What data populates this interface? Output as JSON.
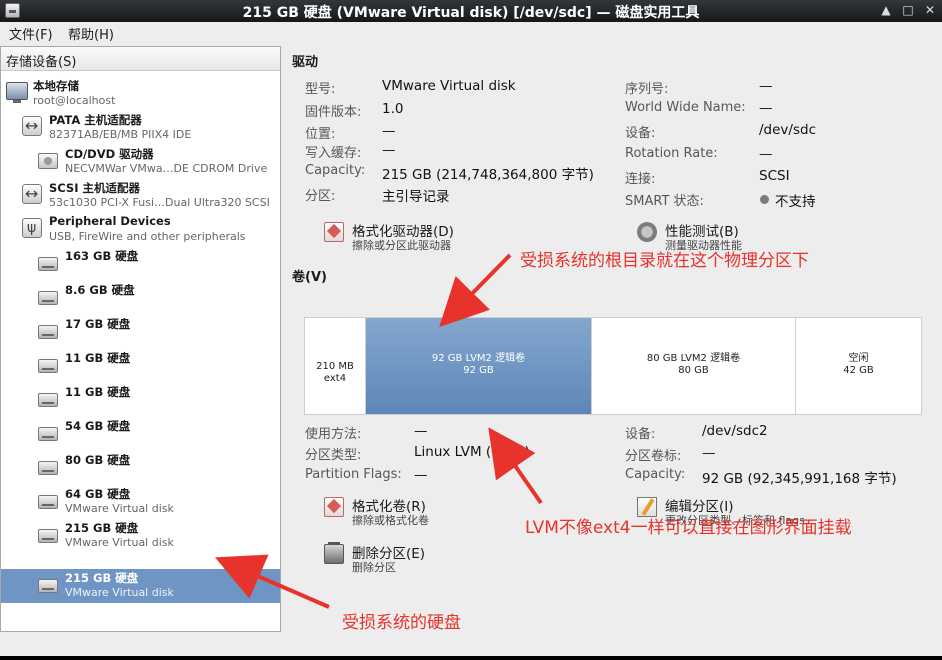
{
  "window": {
    "title": "215 GB 硬盘 (VMware Virtual disk) [/dev/sdc] — 磁盘实用工具",
    "controls": {
      "minimize": "▲",
      "close": "✕"
    }
  },
  "menubar": {
    "items": [
      "文件(F)",
      "帮助(H)"
    ]
  },
  "sidebar": {
    "header": "存储设备(S)",
    "items": [
      {
        "title": "本地存储",
        "sub": "root@localhost",
        "icon": "computer-icon"
      },
      {
        "title": "PATA 主机适配器",
        "sub": "82371AB/EB/MB PIIX4 IDE",
        "icon": "hba-icon"
      },
      {
        "title": "CD/DVD 驱动器",
        "sub": "NECVMWar VMwa…DE CDROM Drive",
        "icon": "cdrom-icon"
      },
      {
        "title": "SCSI 主机适配器",
        "sub": "53c1030 PCI-X Fusi…Dual Ultra320 SCSI",
        "icon": "hba-icon"
      },
      {
        "title": "Peripheral Devices",
        "sub": "USB, FireWire and other peripherals",
        "icon": "usb-icon"
      },
      {
        "title": "163 GB 硬盘",
        "sub": "",
        "icon": "disk-icon"
      },
      {
        "title": "8.6 GB 硬盘",
        "sub": "",
        "icon": "disk-icon"
      },
      {
        "title": "17 GB 硬盘",
        "sub": "",
        "icon": "disk-icon"
      },
      {
        "title": "11 GB 硬盘",
        "sub": "",
        "icon": "disk-icon"
      },
      {
        "title": "11 GB 硬盘",
        "sub": "",
        "icon": "disk-icon"
      },
      {
        "title": "54 GB 硬盘",
        "sub": "",
        "icon": "disk-icon"
      },
      {
        "title": "80 GB 硬盘",
        "sub": "",
        "icon": "disk-icon"
      },
      {
        "title": "64 GB 硬盘",
        "sub": "VMware Virtual disk",
        "icon": "disk-icon"
      },
      {
        "title": "215 GB 硬盘",
        "sub": "VMware Virtual disk",
        "icon": "disk-icon"
      },
      {
        "title": "215 GB 硬盘",
        "sub": "VMware Virtual disk",
        "icon": "disk-icon",
        "selected": true
      }
    ]
  },
  "drive": {
    "section_title": "驱动",
    "left": [
      {
        "label": "型号:",
        "value": "VMware Virtual disk"
      },
      {
        "label": "固件版本:",
        "value": "1.0"
      },
      {
        "label": "位置:",
        "value": "—"
      },
      {
        "label": "写入缓存:",
        "value": "—"
      },
      {
        "label": "Capacity:",
        "value": "215 GB (214,748,364,800 字节)"
      },
      {
        "label": "分区:",
        "value": "主引导记录"
      }
    ],
    "right": [
      {
        "label": "序列号:",
        "value": "—"
      },
      {
        "label": "World Wide Name:",
        "value": "—"
      },
      {
        "label": "设备:",
        "value": "/dev/sdc"
      },
      {
        "label": "Rotation Rate:",
        "value": "—"
      },
      {
        "label": "连接:",
        "value": "SCSI"
      },
      {
        "label": "SMART 状态:",
        "value": "不支持"
      }
    ],
    "actions": [
      {
        "label": "格式化驱动器(D)",
        "desc": "擦除或分区此驱动器",
        "icon": "format-icon"
      },
      {
        "label": "性能测试(B)",
        "desc": "测量驱动器性能",
        "icon": "benchmark-icon"
      }
    ]
  },
  "volumes": {
    "section_title": "卷(V)",
    "segments": [
      {
        "label1": "210 MB ext4",
        "label2": "",
        "kind": "ext4"
      },
      {
        "label1": "92 GB LVM2 逻辑卷",
        "label2": "92 GB",
        "kind": "selected"
      },
      {
        "label1": "80 GB LVM2 逻辑卷",
        "label2": "80 GB",
        "kind": "lvm80"
      },
      {
        "label1": "空闲",
        "label2": "42 GB",
        "kind": "free"
      }
    ],
    "left": [
      {
        "label": "使用方法:",
        "value": "—"
      },
      {
        "label": "分区类型:",
        "value": "Linux LVM (0x8e)"
      },
      {
        "label": "Partition Flags:",
        "value": "—"
      }
    ],
    "right": [
      {
        "label": "设备:",
        "value": "/dev/sdc2"
      },
      {
        "label": "分区卷标:",
        "value": "—"
      },
      {
        "label": "Capacity:",
        "value": "92 GB (92,345,991,168 字节)"
      }
    ],
    "actions": [
      {
        "label": "格式化卷(R)",
        "desc": "擦除或格式化卷",
        "icon": "format-icon"
      },
      {
        "label": "编辑分区(I)",
        "desc": "更改分区类型、标签和 flags",
        "icon": "edit-icon"
      },
      {
        "label": "删除分区(E)",
        "desc": "删除分区",
        "icon": "delete-icon"
      }
    ]
  },
  "annotations": [
    {
      "text": "受损系统的根目录就在这个物理分区下",
      "color": "#e8322c"
    },
    {
      "text": "LVM不像ext4一样可以直接在图形界面挂载",
      "color": "#e8322c"
    },
    {
      "text": "受损系统的硬盘",
      "color": "#e8322c"
    }
  ]
}
